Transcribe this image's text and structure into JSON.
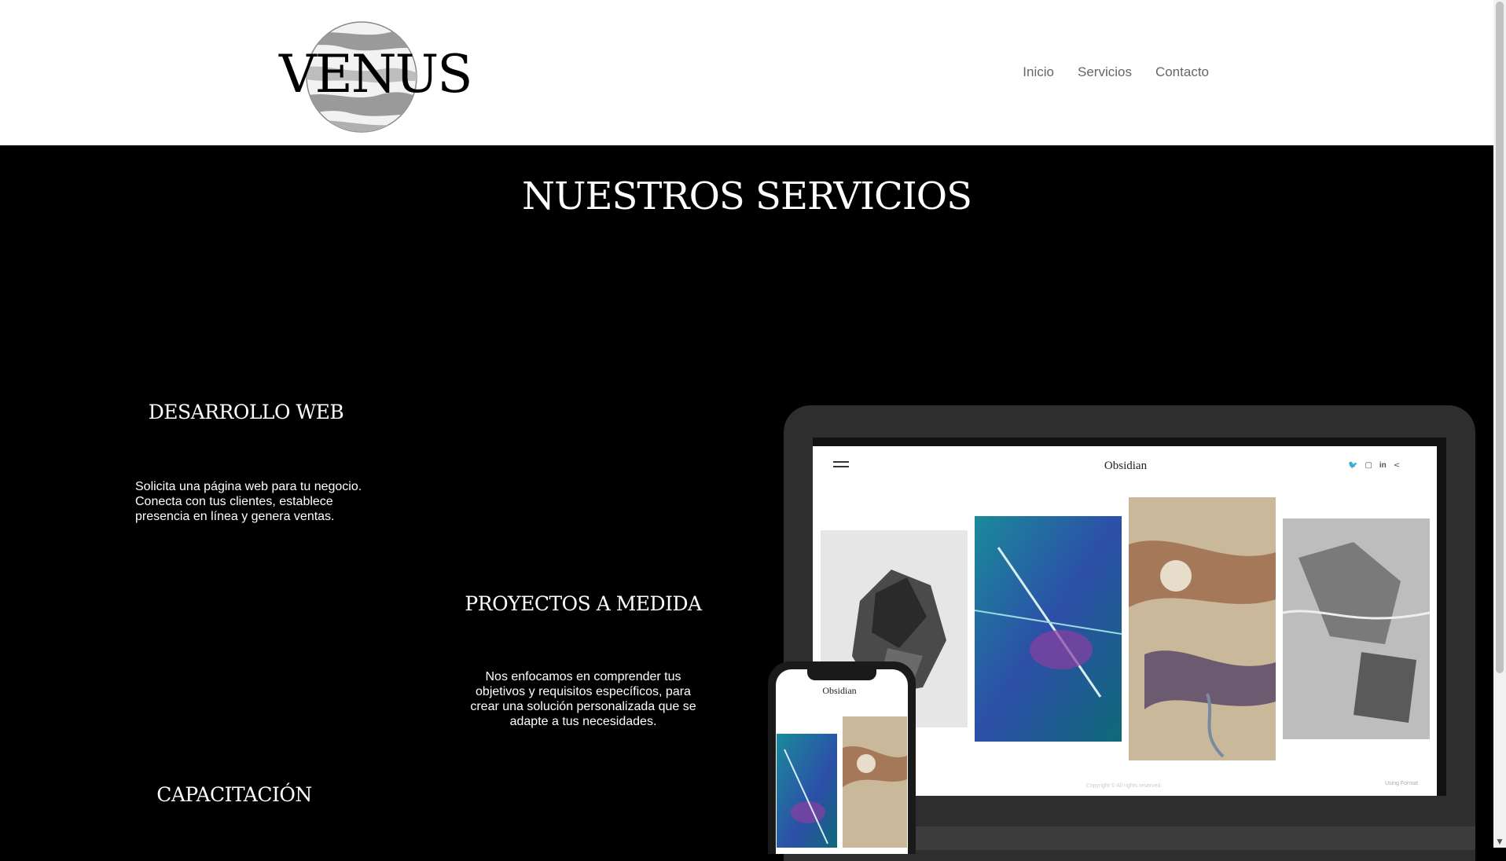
{
  "header": {
    "logo_text": "VENUS",
    "nav": [
      "Inicio",
      "Servicios",
      "Contacto"
    ]
  },
  "main": {
    "title": "NUESTROS SERVICIOS",
    "services": [
      {
        "title": "DESARROLLO WEB",
        "desc": "Solicita una página web para tu negocio. Conecta con tus clientes, establece presencia en línea y genera ventas."
      },
      {
        "title": "PROYECTOS A MEDIDA",
        "desc": "Nos enfocamos en comprender tus objetivos y requisitos específicos, para crear una solución personalizada que se adapte a tus necesidades."
      },
      {
        "title": "CAPACITACIÓN",
        "desc": ""
      }
    ]
  },
  "mockup": {
    "site_name": "Obsidian",
    "social": [
      "twitter-icon",
      "instagram-icon",
      "linkedin-icon",
      "share-icon"
    ],
    "copyright": "Copyright © All rights reserved.",
    "using": "Using Format"
  },
  "colors": {
    "background": "#000000",
    "header": "#ffffff",
    "nav_text": "#666666"
  }
}
